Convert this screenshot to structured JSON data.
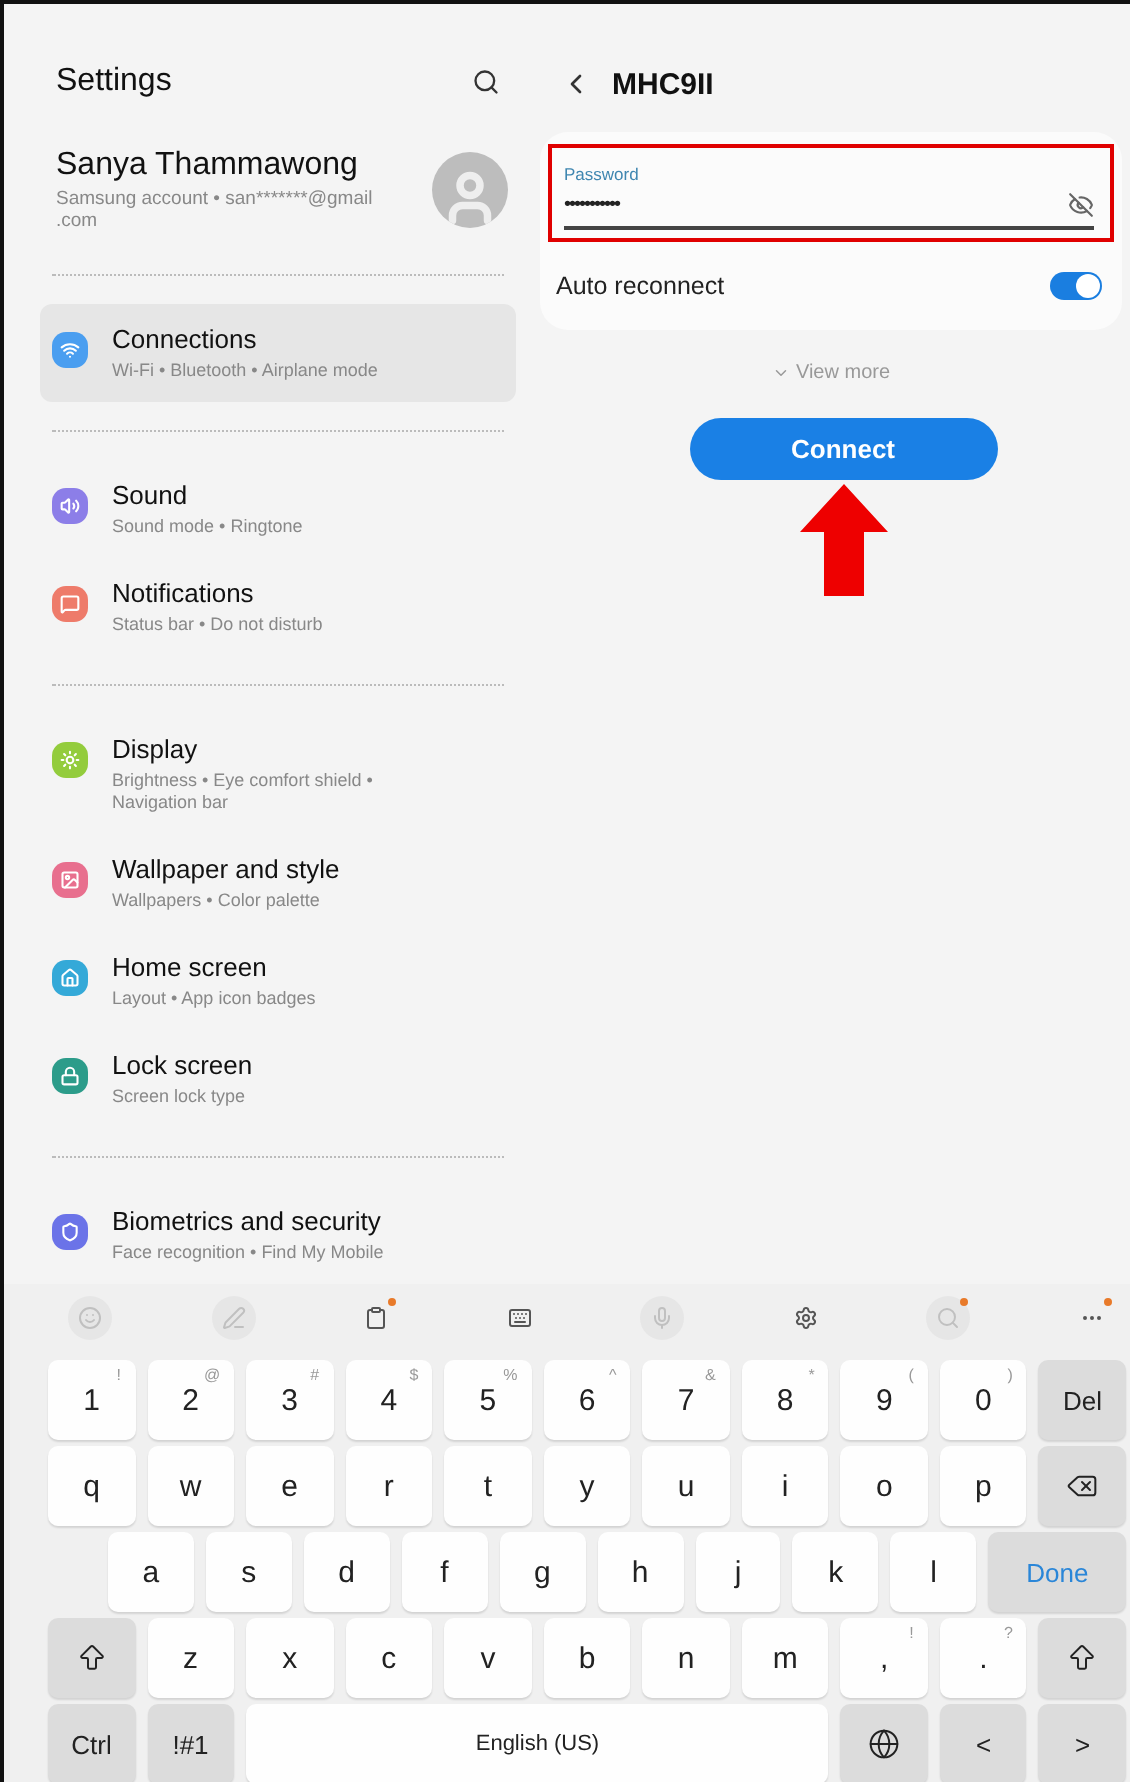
{
  "sidebar": {
    "title": "Settings",
    "profile": {
      "name": "Sanya Thammawong",
      "subtitle": "Samsung account • san*******@gmail .com"
    },
    "groups": [
      [
        {
          "kind": "wifi",
          "title": "Connections",
          "subtitle": "Wi-Fi • Bluetooth • Airplane mode",
          "color": "#4a9ef0",
          "selected": true
        }
      ],
      [
        {
          "kind": "sound",
          "title": "Sound",
          "subtitle": "Sound mode • Ringtone",
          "color": "#8c7ee8",
          "selected": false
        },
        {
          "kind": "notification",
          "title": "Notifications",
          "subtitle": "Status bar • Do not disturb",
          "color": "#ee7b6a",
          "selected": false
        }
      ],
      [
        {
          "kind": "display",
          "title": "Display",
          "subtitle": "Brightness • Eye comfort shield • Navigation bar",
          "color": "#93cc3c",
          "selected": false
        },
        {
          "kind": "wallpaper",
          "title": "Wallpaper and style",
          "subtitle": "Wallpapers • Color palette",
          "color": "#e86f8e",
          "selected": false
        },
        {
          "kind": "home",
          "title": "Home screen",
          "subtitle": "Layout • App icon badges",
          "color": "#34a9d8",
          "selected": false
        },
        {
          "kind": "lock",
          "title": "Lock screen",
          "subtitle": "Screen lock type",
          "color": "#2c9c8a",
          "selected": false
        }
      ],
      [
        {
          "kind": "shield",
          "title": "Biometrics and security",
          "subtitle": "Face recognition • Find My Mobile",
          "color": "#6b73e8",
          "selected": false
        }
      ]
    ]
  },
  "network": {
    "title": "MHC9II",
    "password": {
      "label": "Password",
      "value": "•••••••••••"
    },
    "auto_reconnect": {
      "label": "Auto reconnect",
      "on": true
    },
    "view_more": "View more",
    "connect": "Connect"
  },
  "keyboard": {
    "toolbar": [
      {
        "kind": "emoji",
        "disabled": true,
        "badge": false
      },
      {
        "kind": "handwriting",
        "disabled": true,
        "badge": false
      },
      {
        "kind": "clipboard",
        "disabled": false,
        "badge": true
      },
      {
        "kind": "keyboard",
        "disabled": false,
        "badge": false
      },
      {
        "kind": "mic",
        "disabled": true,
        "badge": false
      },
      {
        "kind": "settings",
        "disabled": false,
        "badge": false
      },
      {
        "kind": "search",
        "disabled": true,
        "badge": true
      },
      {
        "kind": "more",
        "disabled": false,
        "badge": true
      }
    ],
    "rows": [
      {
        "keys": [
          {
            "kind": "char",
            "label": "1",
            "sub": "!"
          },
          {
            "kind": "char",
            "label": "2",
            "sub": "@"
          },
          {
            "kind": "char",
            "label": "3",
            "sub": "#"
          },
          {
            "kind": "char",
            "label": "4",
            "sub": "$"
          },
          {
            "kind": "char",
            "label": "5",
            "sub": "%"
          },
          {
            "kind": "char",
            "label": "6",
            "sub": "^"
          },
          {
            "kind": "char",
            "label": "7",
            "sub": "&"
          },
          {
            "kind": "char",
            "label": "8",
            "sub": "*"
          },
          {
            "kind": "char",
            "label": "9",
            "sub": "("
          },
          {
            "kind": "char",
            "label": "0",
            "sub": ")"
          },
          {
            "kind": "function",
            "label": "Del"
          }
        ]
      },
      {
        "keys": [
          {
            "kind": "char",
            "label": "q"
          },
          {
            "kind": "char",
            "label": "w"
          },
          {
            "kind": "char",
            "label": "e"
          },
          {
            "kind": "char",
            "label": "r"
          },
          {
            "kind": "char",
            "label": "t"
          },
          {
            "kind": "char",
            "label": "y"
          },
          {
            "kind": "char",
            "label": "u"
          },
          {
            "kind": "char",
            "label": "i"
          },
          {
            "kind": "char",
            "label": "o"
          },
          {
            "kind": "char",
            "label": "p"
          },
          {
            "kind": "backspace"
          }
        ]
      },
      {
        "keys": [
          {
            "kind": "char",
            "label": "a"
          },
          {
            "kind": "char",
            "label": "s"
          },
          {
            "kind": "char",
            "label": "d"
          },
          {
            "kind": "char",
            "label": "f"
          },
          {
            "kind": "char",
            "label": "g"
          },
          {
            "kind": "char",
            "label": "h"
          },
          {
            "kind": "char",
            "label": "j"
          },
          {
            "kind": "char",
            "label": "k"
          },
          {
            "kind": "char",
            "label": "l"
          },
          {
            "kind": "action",
            "label": "Done"
          }
        ]
      },
      {
        "keys": [
          {
            "kind": "shift"
          },
          {
            "kind": "char",
            "label": "z"
          },
          {
            "kind": "char",
            "label": "x"
          },
          {
            "kind": "char",
            "label": "c"
          },
          {
            "kind": "char",
            "label": "v"
          },
          {
            "kind": "char",
            "label": "b"
          },
          {
            "kind": "char",
            "label": "n"
          },
          {
            "kind": "char",
            "label": "m"
          },
          {
            "kind": "char",
            "label": ",",
            "sub": "!"
          },
          {
            "kind": "char",
            "label": ".",
            "sub": "?"
          },
          {
            "kind": "shift"
          }
        ]
      },
      {
        "keys": [
          {
            "kind": "function",
            "label": "Ctrl"
          },
          {
            "kind": "function",
            "label": "!#1"
          },
          {
            "kind": "space",
            "label": "English (US)"
          },
          {
            "kind": "globe"
          },
          {
            "kind": "function",
            "label": "<"
          },
          {
            "kind": "function",
            "label": ">"
          }
        ]
      }
    ]
  }
}
